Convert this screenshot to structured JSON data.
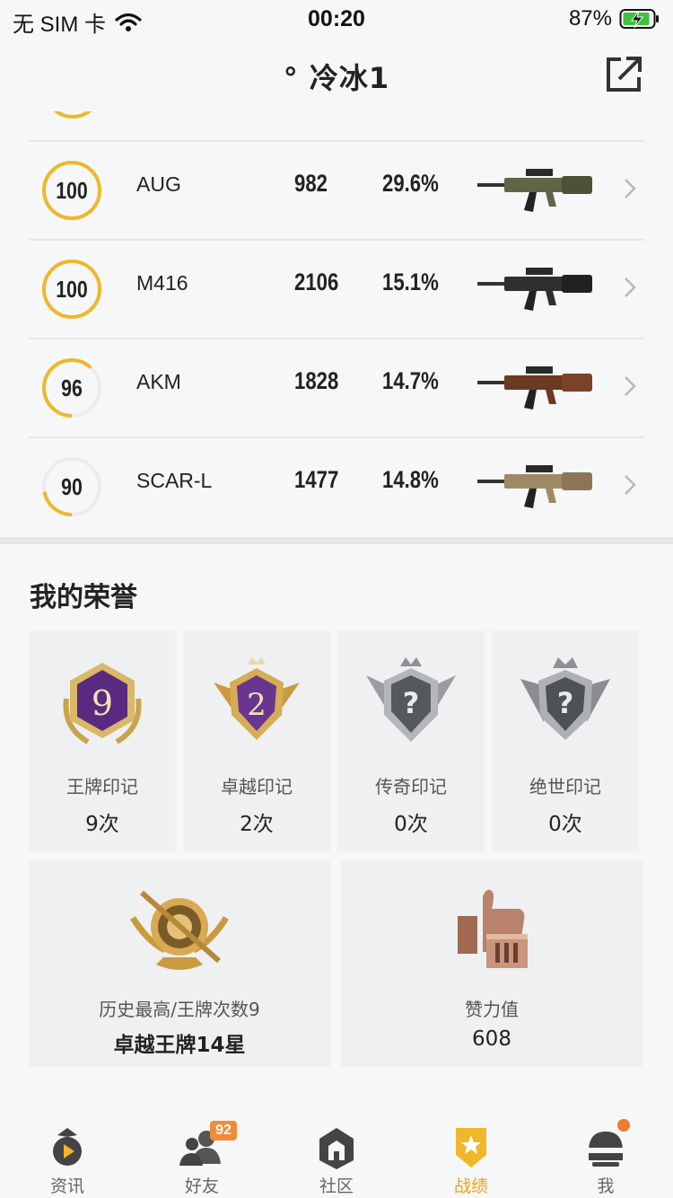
{
  "status_bar": {
    "carrier": "无 SIM 卡",
    "time": "00:20",
    "battery": "87%"
  },
  "header": {
    "title": "°  冷冰1"
  },
  "weapons": [
    {
      "level": "100",
      "progress": 1.0,
      "name": "AUG",
      "kills": "982",
      "rate": "29.6%",
      "icon": "aug-rifle-icon"
    },
    {
      "level": "100",
      "progress": 1.0,
      "name": "M416",
      "kills": "2106",
      "rate": "15.1%",
      "icon": "m416-rifle-icon"
    },
    {
      "level": "96",
      "progress": 0.62,
      "name": "AKM",
      "kills": "1828",
      "rate": "14.7%",
      "icon": "akm-rifle-icon"
    },
    {
      "level": "90",
      "progress": 0.22,
      "name": "SCAR-L",
      "kills": "1477",
      "rate": "14.8%",
      "icon": "scar-l-rifle-icon"
    }
  ],
  "honor": {
    "title": "我的荣誉",
    "badges": [
      {
        "label": "王牌印记",
        "count": "9次",
        "icon": "ace-emblem-icon",
        "emblem_text": "9"
      },
      {
        "label": "卓越印记",
        "count": "2次",
        "icon": "excellence-emblem-icon",
        "emblem_text": "2"
      },
      {
        "label": "传奇印记",
        "count": "0次",
        "icon": "legend-emblem-icon",
        "emblem_text": "?"
      },
      {
        "label": "绝世印记",
        "count": "0次",
        "icon": "peerless-emblem-icon",
        "emblem_text": "?"
      }
    ],
    "best": {
      "label": "历史最高/王牌次数9",
      "value": "卓越王牌14星",
      "icon": "ace-tier-badge-icon"
    },
    "likes": {
      "label": "赞力值",
      "value": "608",
      "icon": "thumbs-up-trophy-icon"
    }
  },
  "tabs": [
    {
      "label": "资讯",
      "icon": "news-icon",
      "active": false
    },
    {
      "label": "好友",
      "icon": "friends-icon",
      "active": false,
      "badge": "92"
    },
    {
      "label": "社区",
      "icon": "community-icon",
      "active": false
    },
    {
      "label": "战绩",
      "icon": "record-icon",
      "active": true
    },
    {
      "label": "我",
      "icon": "profile-icon",
      "active": false
    }
  ],
  "colors": {
    "accent": "#f0a31d",
    "ring_track": "#e6e6e6",
    "tab_badge": "#ef8b3b"
  }
}
